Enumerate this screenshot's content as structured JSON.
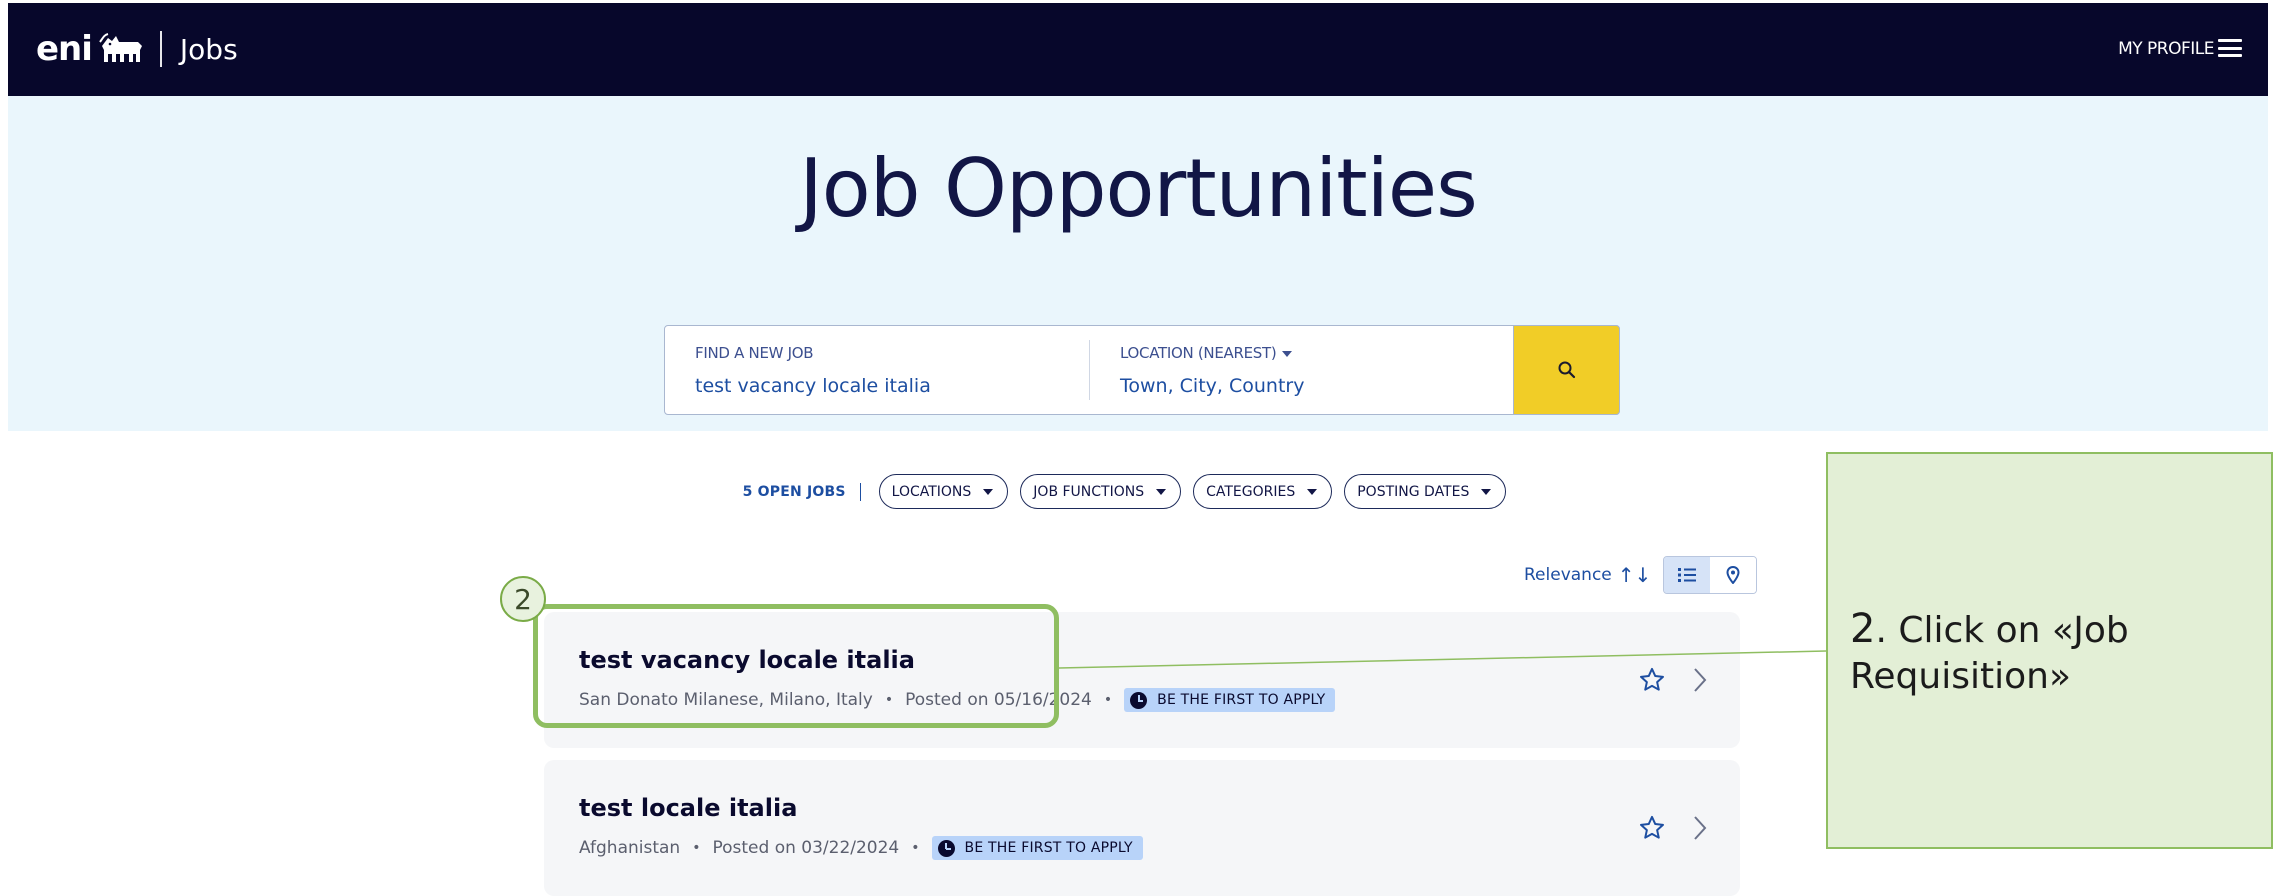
{
  "header": {
    "brand": "eni",
    "section": "Jobs",
    "profile_label": "MY PROFILE"
  },
  "hero": {
    "title": "Job Opportunities"
  },
  "search": {
    "job_label": "FIND A NEW JOB",
    "job_value": "test vacancy locale italia",
    "location_label": "LOCATION (NEAREST)",
    "location_placeholder": "Town, City, Country"
  },
  "filters": {
    "open_jobs": "5 OPEN JOBS",
    "items": [
      "LOCATIONS",
      "JOB FUNCTIONS",
      "CATEGORIES",
      "POSTING DATES"
    ]
  },
  "sort": {
    "label": "Relevance"
  },
  "jobs": [
    {
      "title": "test vacancy locale italia",
      "location": "San Donato Milanese, Milano, Italy",
      "posted": "Posted on 05/16/2024",
      "badge": "BE THE FIRST TO APPLY"
    },
    {
      "title": "test locale italia",
      "location": "Afghanistan",
      "posted": "Posted on 03/22/2024",
      "badge": "BE THE FIRST TO APPLY"
    }
  ],
  "annotation": {
    "step": "2",
    "step_prefix": "2",
    "instruction": ". Click on «",
    "target": "Job Requisition",
    "suffix": "»"
  },
  "colors": {
    "navbar": "#07072b",
    "hero_bg": "#eaf6fc",
    "search_button": "#f1cd27",
    "accent_blue": "#1d4ea1",
    "badge_bg": "#b8d3f9",
    "annotation_green": "#8fbe61",
    "annotation_bg": "#e3efd6"
  }
}
